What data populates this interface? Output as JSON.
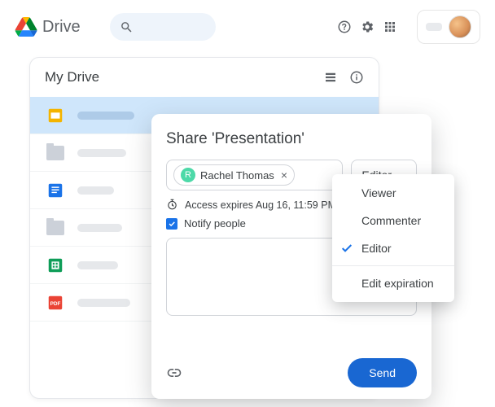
{
  "top": {
    "product": "Drive"
  },
  "window": {
    "title": "My Drive"
  },
  "share": {
    "title": "Share 'Presentation'",
    "person": {
      "initial": "R",
      "name": "Rachel Thomas"
    },
    "role_button": "Editor",
    "expires": "Access expires Aug 16, 11:59 PM",
    "notify_label": "Notify people",
    "send_label": "Send"
  },
  "menu": {
    "viewer": "Viewer",
    "commenter": "Commenter",
    "editor": "Editor",
    "edit_expiration": "Edit expiration"
  }
}
